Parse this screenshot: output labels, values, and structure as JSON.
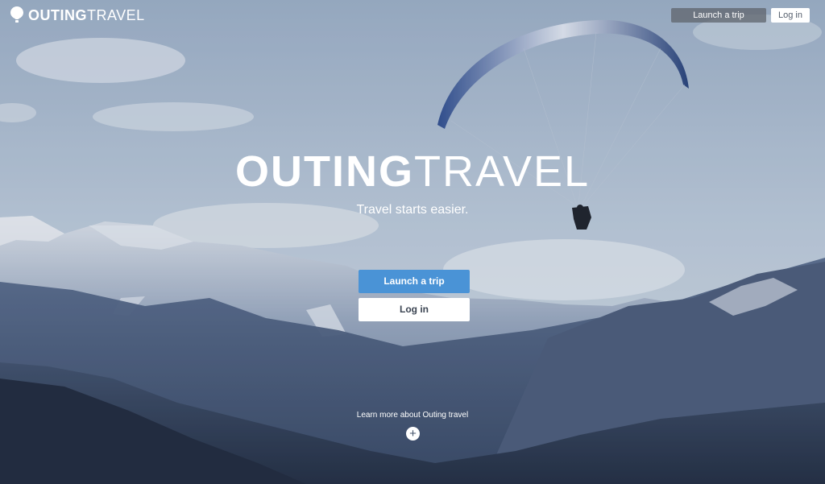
{
  "brand": {
    "name_bold": "OUTING",
    "name_light": "TRAVEL"
  },
  "nav": {
    "launch_label": "Launch a trip",
    "login_label": "Log in"
  },
  "hero": {
    "headline_bold": "OUTING",
    "headline_light": "TRAVEL",
    "tagline": "Travel starts easier.",
    "launch_button": "Launch a trip",
    "login_button": "Log in",
    "learn_more": "Learn more about Outing travel",
    "expand_symbol": "+"
  },
  "colors": {
    "accent": "#4a93d6",
    "nav_launch_bg": "#5f646c",
    "text_on_image": "#ffffff"
  },
  "icons": {
    "logo": "balloon-pin-icon",
    "expand": "plus-circle-icon"
  }
}
